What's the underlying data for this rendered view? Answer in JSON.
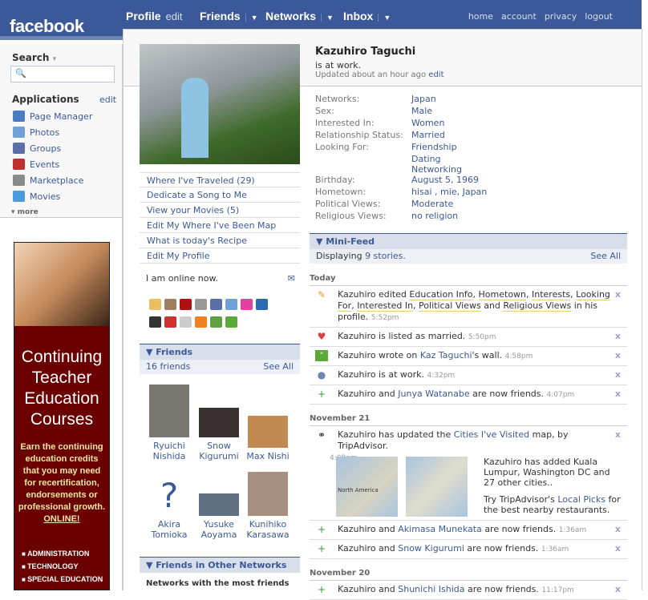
{
  "nav": {
    "logo": "facebook",
    "profile": "Profile",
    "profile_edit": "edit",
    "friends": "Friends",
    "networks": "Networks",
    "inbox": "Inbox",
    "arrow": "▼",
    "right": [
      "home",
      "account",
      "privacy",
      "logout"
    ]
  },
  "sidebar": {
    "search_label": "Search",
    "search_arrow": "▾",
    "apps_label": "Applications",
    "apps_edit": "edit",
    "apps": [
      {
        "label": "Page Manager",
        "color": "#4a7cc4"
      },
      {
        "label": "Photos",
        "color": "#6fa0d8"
      },
      {
        "label": "Groups",
        "color": "#5a6ea8"
      },
      {
        "label": "Events",
        "color": "#c03030"
      },
      {
        "label": "Marketplace",
        "color": "#8a8a8a"
      },
      {
        "label": "Movies",
        "color": "#4a9ae0"
      }
    ],
    "more": "more"
  },
  "ad": {
    "title_lines": [
      "Continuing",
      "Teacher",
      "Education",
      "Courses"
    ],
    "body": "Earn the continuing education credits that you may need for recertification, endorsements or professional growth.",
    "online": "ONLINE!",
    "items": [
      "ADMINISTRATION",
      "TECHNOLOGY",
      "SPECIAL EDUCATION"
    ]
  },
  "profile": {
    "name": "Kazuhiro Taguchi",
    "status": "is at work.",
    "updated": "Updated about an hour ago",
    "updated_edit": "edit",
    "actions": [
      "Where I've Traveled (29)",
      "Dedicate a Song to Me",
      "View your Movies (5)",
      "Edit My Where I've Been Map",
      "What is today's Recipe",
      "Edit My Profile"
    ],
    "online": "I am online now.",
    "info": [
      {
        "k": "Networks:",
        "v": "Japan"
      },
      {
        "k": "Sex:",
        "v": "Male"
      },
      {
        "k": "Interested In:",
        "v": "Women"
      },
      {
        "k": "Relationship Status:",
        "v": "Married"
      },
      {
        "k": "Looking For:",
        "v": "Friendship"
      },
      {
        "k": "",
        "v": "Dating"
      },
      {
        "k": "",
        "v": "Networking"
      }
    ],
    "info2": [
      {
        "k": "Birthday:",
        "v": "August 5, 1969"
      },
      {
        "k": "Hometown:",
        "v": "hisai , mie, Japan"
      },
      {
        "k": "Political Views:",
        "v": "Moderate"
      },
      {
        "k": "Religious Views:",
        "v": "no religion"
      }
    ]
  },
  "friends": {
    "title": "Friends",
    "count": "16 friends",
    "see_all": "See All",
    "list": [
      {
        "first": "Ryuichi",
        "last": "Nishida"
      },
      {
        "first": "Snow",
        "last": "Kigurumi"
      },
      {
        "first": "Max Nishi",
        "last": ""
      },
      {
        "first": "Akira",
        "last": "Tomioka"
      },
      {
        "first": "Yusuke",
        "last": "Aoyama"
      },
      {
        "first": "Kunihiko",
        "last": "Karasawa"
      }
    ],
    "other_title": "Friends in Other Networks",
    "other_sub": "Networks with the most friends"
  },
  "minifeed": {
    "title": "Mini-Feed",
    "displaying": "Displaying",
    "count": "9 stories.",
    "see_all": "See All",
    "today": "Today",
    "nov21": "November 21",
    "nov20": "November 20",
    "s1": {
      "a": "Kazuhiro edited",
      "l1": "Education Info",
      "l2": "Hometown",
      "l3": "Interests",
      "l4": "Looking For",
      "l5": "Interested In",
      "l6": "Political Views",
      "and": "and",
      "l7": "Religious Views",
      "b": "in his profile.",
      "t": "5:52pm"
    },
    "s2": {
      "a": "Kazuhiro is listed as married.",
      "t": "5:50pm"
    },
    "s3": {
      "a": "Kazuhiro wrote on",
      "l": "Kaz Taguchi",
      "b": "'s wall.",
      "t": "4:58pm"
    },
    "s4": {
      "a": "Kazuhiro is at work.",
      "t": "4:32pm"
    },
    "s5": {
      "a": "Kazuhiro and",
      "l": "Junya Watanabe",
      "b": "are now friends.",
      "t": "4:07pm"
    },
    "s6": {
      "a": "Kazuhiro has updated the",
      "l": "Cities I've Visited",
      "b": "map, by TripAdvisor.",
      "t": "4:08am",
      "p1": "Kazuhiro has added Kuala Lumpur, Washington DC and 27 other cities..",
      "p2a": "Try TripAdvisor's",
      "p2l": "Local Picks",
      "p2b": "for the best nearby restaurants.",
      "map1": "North America"
    },
    "s7": {
      "a": "Kazuhiro and",
      "l": "Akimasa Munekata",
      "b": "are now friends.",
      "t": "1:36am"
    },
    "s8": {
      "a": "Kazuhiro and",
      "l": "Snow Kigurumi",
      "b": "are now friends.",
      "t": "1:36am"
    },
    "s9": {
      "a": "Kazuhiro and",
      "l": "Shunichi Ishida",
      "b": "are now friends.",
      "t": "11:17pm"
    },
    "close": "x"
  }
}
